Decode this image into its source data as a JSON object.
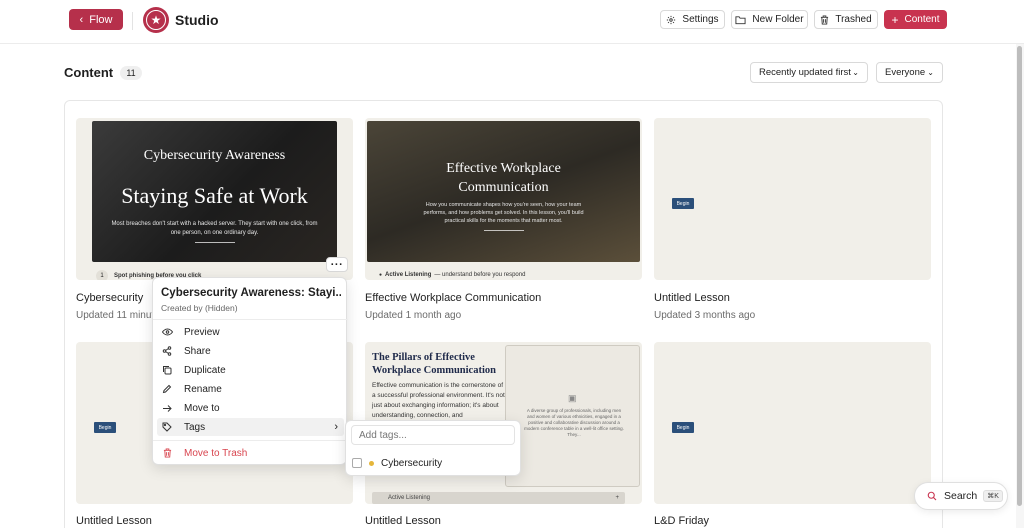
{
  "header": {
    "flow_label": "Flow",
    "brand": "Studio",
    "settings_label": "Settings",
    "new_folder_label": "New Folder",
    "trashed_label": "Trashed",
    "content_label": "Content"
  },
  "toolbar": {
    "section_title": "Content",
    "count": "11",
    "sort_label": "Recently updated first",
    "filter_label": "Everyone"
  },
  "cards": [
    {
      "title": "Cybersecurity",
      "updated": "Updated 11 minut",
      "slide_title": "Cybersecurity Awareness",
      "slide_headline": "Staying Safe at Work",
      "slide_body": "Most breaches don't start with a hacked server. They start with one click, from one person, on one ordinary day.",
      "step_num": "1",
      "step_text": "Spot phishing before you click"
    },
    {
      "title": "Effective Workplace Communication",
      "updated": "Updated 1 month ago",
      "slide_title": "Effective Workplace Communication",
      "slide_body": "How you communicate shapes how you're seen, how your team performs, and how problems get solved. In this lesson, you'll build practical skills for the moments that matter most.",
      "footer_label": "Active Listening",
      "footer_text": "— understand before you respond"
    },
    {
      "title": "Untitled Lesson",
      "updated": "Updated 3 months ago",
      "begin": "Begin"
    },
    {
      "title": "Untitled Lesson",
      "begin": "Begin"
    },
    {
      "title": "Untitled Lesson",
      "doc_title": "The Pillars of Effective Workplace Communication",
      "doc_body": "Effective communication is the cornerstone of a successful professional environment. It's not just about exchanging information; it's about understanding, connection, and",
      "image_caption": "A diverse group of professionals, including men and women of various ethnicities, engaged in a positive and collaborative discussion around a modern conference table in a well-lit office setting. They...",
      "footer_label": "Active Listening",
      "footer_plus": "+"
    },
    {
      "title": "L&D Friday",
      "begin": "Begin"
    }
  ],
  "context_menu": {
    "title": "Cybersecurity Awareness: Stayi...",
    "created_by": "Created by (Hidden)",
    "items": [
      {
        "label": "Preview",
        "icon": "eye-icon"
      },
      {
        "label": "Share",
        "icon": "share-icon"
      },
      {
        "label": "Duplicate",
        "icon": "copy-icon"
      },
      {
        "label": "Rename",
        "icon": "pencil-icon"
      },
      {
        "label": "Move to",
        "icon": "arrow-right-icon"
      },
      {
        "label": "Tags",
        "icon": "tag-icon"
      },
      {
        "label": "Move to Trash",
        "icon": "trash-icon"
      }
    ]
  },
  "tags_menu": {
    "placeholder": "Add tags...",
    "tags": [
      {
        "label": "Cybersecurity",
        "color": "#e5b63a",
        "checked": false
      }
    ]
  },
  "search": {
    "label": "Search",
    "shortcut": "⌘K"
  },
  "colors": {
    "accent": "#b6304b",
    "danger": "#d8454f",
    "begin_button": "#2b4f7a"
  }
}
